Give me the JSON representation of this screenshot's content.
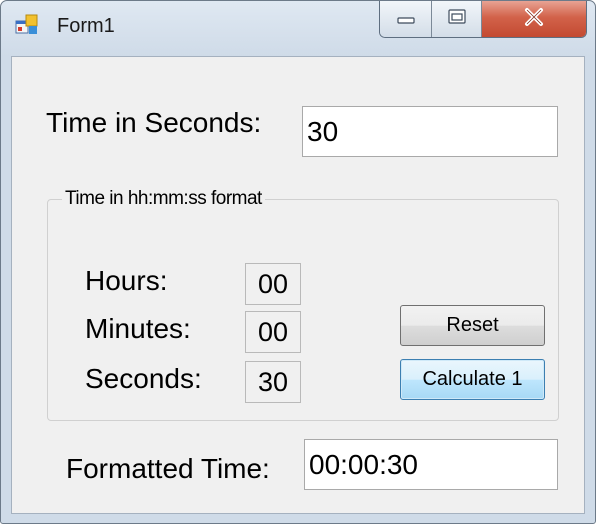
{
  "window": {
    "title": "Form1"
  },
  "time_in_seconds": {
    "label": "Time in Seconds:",
    "value": "30"
  },
  "group": {
    "legend": "Time in hh:mm:ss format",
    "hours_label": "Hours:",
    "hours_value": "00",
    "minutes_label": "Minutes:",
    "minutes_value": "00",
    "seconds_label": "Seconds:",
    "seconds_value": "30"
  },
  "buttons": {
    "reset": "Reset",
    "calculate": "Calculate 1"
  },
  "formatted_time": {
    "label": "Formatted Time:",
    "value": "00:00:30"
  },
  "icons": {
    "app": "winforms-app-icon",
    "minimize": "minimize-icon",
    "maximize": "maximize-icon",
    "close": "close-icon"
  },
  "colors": {
    "close_button": "#c9503a",
    "focus_border": "#3c7fb1"
  }
}
